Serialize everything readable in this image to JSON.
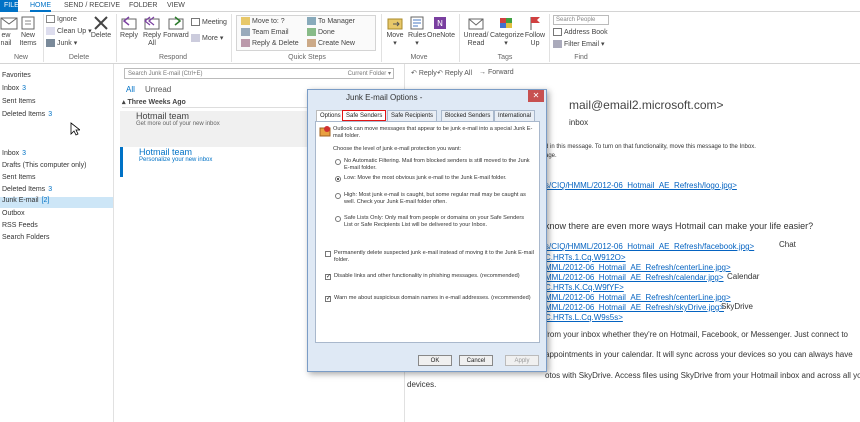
{
  "ribbon_tabs": [
    "FILE",
    "HOME",
    "SEND / RECEIVE",
    "FOLDER",
    "VIEW"
  ],
  "ribbon": {
    "new_email": "ew\nnail",
    "new_items": "New Items",
    "ignore": "Ignore",
    "clean_up": "Clean Up",
    "junk": "Junk",
    "delete": "Delete",
    "reply": "Reply",
    "reply_all": "Reply All",
    "forward": "Forward",
    "meeting": "Meeting",
    "more": "More",
    "qs_move_to": "Move to: ?",
    "qs_team_email": "Team Email",
    "qs_reply_delete": "Reply & Delete",
    "qs_to_manager": "To Manager",
    "qs_done": "Done",
    "qs_create_new": "Create New",
    "move": "Move",
    "rules": "Rules",
    "onenote": "OneNote",
    "unread_read": "Unread/ Read",
    "categorize": "Categorize",
    "follow_up": "Follow Up",
    "search_people": "Search People",
    "address_book": "Address Book",
    "filter_email": "Filter Email",
    "groups": {
      "new": "New",
      "delete": "Delete",
      "respond": "Respond",
      "quick_steps": "Quick Steps",
      "move": "Move",
      "tags": "Tags",
      "find": "Find"
    }
  },
  "folders": {
    "favorites": "Favorites",
    "inbox": "Inbox",
    "inbox_count": "3",
    "sent": "Sent Items",
    "deleted": "Deleted Items",
    "deleted_count": "3",
    "inbox2": "Inbox",
    "inbox2_count": "3",
    "drafts": "Drafts (This computer only)",
    "sent2": "Sent Items",
    "deleted2": "Deleted Items",
    "deleted2_count": "3",
    "junk": "Junk E-mail",
    "junk_count": "[2]",
    "outbox": "Outbox",
    "rss": "RSS Feeds",
    "search_folders": "Search Folders"
  },
  "message_list": {
    "search_placeholder": "Search Junk E-mail (Ctrl+E)",
    "scope": "Current Folder",
    "filter_all": "All",
    "filter_unread": "Unread",
    "group_header": "Three Weeks Ago",
    "mails": [
      {
        "from": "Hotmail team",
        "subject": "Get more out of your new inbox"
      },
      {
        "from": "Hotmail team",
        "subject": "Personalize your new inbox"
      }
    ]
  },
  "reading": {
    "reply": "Reply",
    "reply_all": "Reply All",
    "forward": "Forward",
    "from_email": "mail@email2.microsoft.com>",
    "inbox_word": "inbox",
    "notice": "d in this message. To turn on that functionality, move this message to the Inbox.",
    "notice2": "age.",
    "link_logo": "s/CIQ/HMML/2012-06_Hotmail_AE_Refresh/logo.jpg>",
    "question": "know there are even more ways Hotmail can make your life easier?",
    "link_facebook": "s/CIQ/HMML/2012-06_Hotmail_AE_Refresh/facebook.jpg>",
    "chat": "Chat",
    "link_cq1": "C.HRTs.1.Cq.W912O>",
    "link_centerline1": "MML/2012-06_Hotmail_AE_Refresh/centerLine.jpg>",
    "link_calendar": "MML/2012-06_Hotmail_AE_Refresh/calendar.jpg>",
    "calendar": "Calendar",
    "link_cq2": "C.HRTs.K.Cq.W9fYF>",
    "link_centerline2": "MML/2012-06_Hotmail_AE_Refresh/centerLine.jpg>",
    "link_skydrive": "MML/2012-06_Hotmail_AE_Refresh/skyDrive.jpg>",
    "skydrive": "SkyDrive",
    "link_cq3": "C.HRTs.L.Cq.W9s5s>",
    "body1": "from your inbox whether they're on Hotmail, Facebook, or Messenger. Just connect to",
    "body2": "appointments in your calendar. It will sync across your devices so you can always have",
    "body3": "otos with SkyDrive. Access files using SkyDrive from your Hotmail inbox and across all your",
    "body4": "devices."
  },
  "dialog": {
    "title": "Junk E-mail Options -",
    "close": "✕",
    "tabs": [
      "Options",
      "Safe Senders",
      "Safe Recipients",
      "Blocked Senders",
      "International"
    ],
    "intro": "Outlook can move messages that appear to be junk e-mail into a special Junk E-mail folder.",
    "choose": "Choose the level of junk e-mail protection you want:",
    "opt_none": "No Automatic Filtering. Mail from blocked senders is still moved to the Junk E-mail folder.",
    "opt_low": "Low: Move the most obvious junk e-mail to the Junk E-mail folder.",
    "opt_high": "High: Most junk e-mail is caught, but some regular mail may be caught as well. Check your Junk E-mail folder often.",
    "opt_safe": "Safe Lists Only: Only mail from people or domains on your Safe Senders List or Safe Recipients List will be delivered to your Inbox.",
    "chk_delete": "Permanently delete suspected junk e-mail instead of moving it to the Junk E-mail folder.",
    "chk_links": "Disable links and other functionality in phishing messages. (recommended)",
    "chk_warn": "Warn me about suspicious domain names in e-mail addresses. (recommended)",
    "ok": "OK",
    "cancel": "Cancel",
    "apply": "Apply"
  }
}
